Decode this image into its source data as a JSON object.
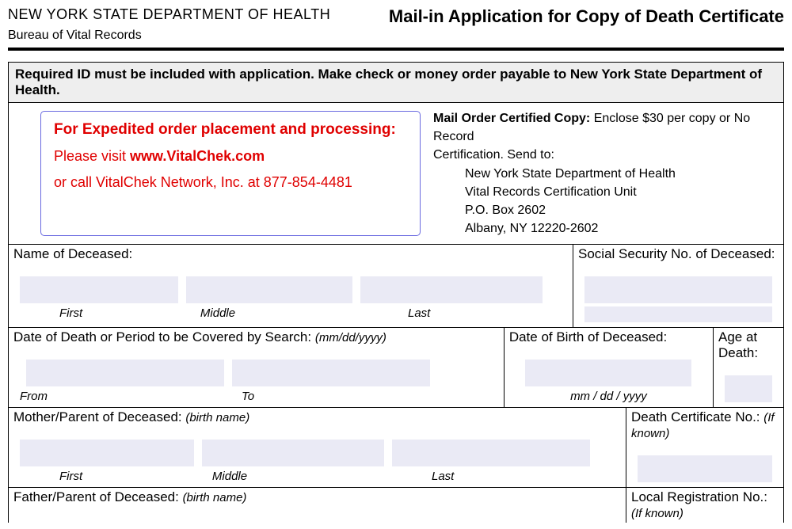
{
  "header": {
    "department": "NEW YORK STATE DEPARTMENT OF HEALTH",
    "bureau": "Bureau of Vital Records",
    "title": "Mail-in Application for Copy of Death Certificate"
  },
  "banner": "Required ID must be included with application.  Make check or money order payable to New York State Department of Health.",
  "expedite": {
    "line1": "For Expedited order placement and processing:",
    "line2a": "Please visit ",
    "line2b": "www.VitalChek.com",
    "line3": "or call VitalChek Network, Inc. at 877-854-4481"
  },
  "mail": {
    "heading": "Mail Order Certified Copy:",
    "heading_rest": " Enclose $30 per copy or No Record",
    "cert_line": "Certification. Send to:",
    "addr1": "New York State Department of Health",
    "addr2": "Vital Records Certification Unit",
    "addr3": "P.O. Box 2602",
    "addr4": "Albany, NY   12220-2602"
  },
  "fields": {
    "name_label": "Name of Deceased:",
    "ssn_label": "Social Security No. of Deceased:",
    "first": "First",
    "middle": "Middle",
    "last": "Last",
    "death_date_label": "Date of Death or Period to be Covered by Search:  ",
    "death_date_hint": "(mm/dd/yyyy)",
    "from": "From",
    "to": "To",
    "dob_label": "Date of Birth of Deceased:",
    "dob_hint": "mm / dd / yyyy",
    "age_label": "Age at Death:",
    "mother_label": "Mother/Parent of Deceased:  ",
    "birth_name": "(birth name)",
    "cert_no_label": "Death Certificate No.:  ",
    "if_known": "(If known)",
    "father_label": "Father/Parent of Deceased:  ",
    "local_reg_label": "Local Registration No.:  "
  }
}
